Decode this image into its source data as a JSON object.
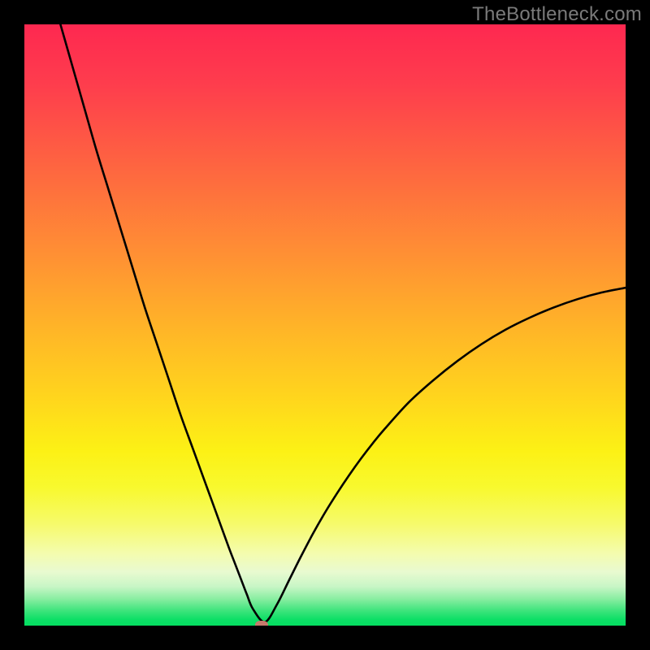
{
  "watermark": "TheBottleneck.com",
  "chart_data": {
    "type": "line",
    "title": "",
    "xlabel": "",
    "ylabel": "",
    "xlim": [
      0,
      100
    ],
    "ylim": [
      0,
      100
    ],
    "grid": false,
    "series": [
      {
        "name": "curve",
        "x": [
          6,
          8,
          10,
          12,
          14,
          16,
          18,
          20,
          22,
          24,
          26,
          28,
          30,
          32,
          34,
          35,
          36,
          37,
          38,
          40,
          42,
          44,
          46,
          48,
          50,
          52,
          54,
          56,
          58,
          60,
          64,
          68,
          72,
          76,
          80,
          84,
          88,
          92,
          96,
          100
        ],
        "y": [
          100,
          93,
          86,
          79,
          72.5,
          66,
          59.5,
          53,
          47,
          41,
          35,
          29.5,
          24,
          18.5,
          13,
          10.4,
          7.8,
          5.2,
          2.8,
          0.6,
          3.5,
          7.5,
          11.5,
          15.3,
          18.8,
          22.0,
          25.0,
          27.8,
          30.4,
          32.8,
          37.2,
          40.8,
          44.0,
          46.8,
          49.2,
          51.2,
          52.9,
          54.3,
          55.4,
          56.2
        ]
      }
    ],
    "marker_point": {
      "x": 39.5,
      "y": 0
    },
    "gradient_colors": {
      "top": "#fe2850",
      "mid_high": "#ffb328",
      "mid_low": "#fcf115",
      "bottom": "#05de61"
    }
  }
}
